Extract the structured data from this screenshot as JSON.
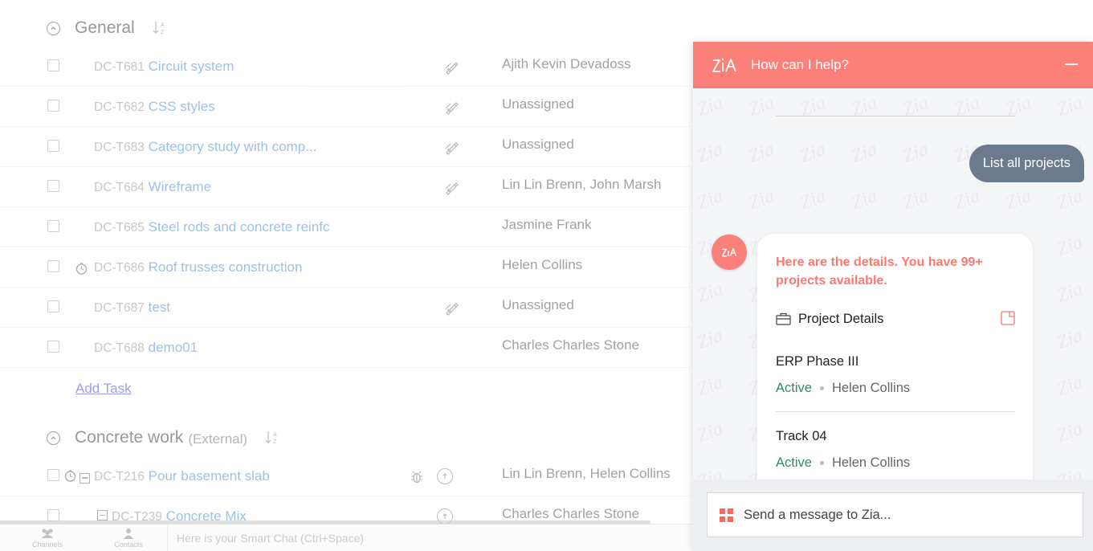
{
  "groups": [
    {
      "title": "General",
      "subtitle": "",
      "tasks": [
        {
          "id": "DC-T681",
          "name": "Circuit system",
          "owner": "Ajith Kevin Devadoss",
          "icon": "pencil-ruler-icon",
          "timer": false
        },
        {
          "id": "DC-T682",
          "name": "CSS styles",
          "owner": "Unassigned",
          "icon": "pencil-ruler-icon",
          "timer": false
        },
        {
          "id": "DC-T683",
          "name": "Category study with comp...",
          "owner": "Unassigned",
          "icon": "pencil-ruler-icon",
          "timer": false
        },
        {
          "id": "DC-T684",
          "name": "Wireframe",
          "owner": "Lin Lin Brenn, John Marsh",
          "icon": "pencil-ruler-icon",
          "timer": false
        },
        {
          "id": "DC-T685",
          "name": "Steel rods and concrete reinfc",
          "owner": "Jasmine Frank",
          "icon": "",
          "timer": false
        },
        {
          "id": "DC-T686",
          "name": "Roof trusses construction",
          "owner": "Helen Collins",
          "icon": "",
          "timer": true
        },
        {
          "id": "DC-T687",
          "name": "test",
          "owner": "Unassigned",
          "icon": "pencil-ruler-icon",
          "timer": false
        },
        {
          "id": "DC-T688",
          "name": "demo01",
          "owner": "Charles Charles Stone",
          "icon": "",
          "timer": false
        }
      ],
      "add_task_label": "Add Task"
    },
    {
      "title": "Concrete work",
      "subtitle": "(External)",
      "tasks": [
        {
          "id": "DC-T216",
          "name": "Pour basement slab",
          "owner": "Lin Lin Brenn, Helen Collins",
          "icon": "bug-icon",
          "timer": true
        },
        {
          "id": "DC-T239",
          "name": "Concrete Mix",
          "owner": "Charles Charles Stone",
          "icon": "",
          "timer": false
        }
      ]
    }
  ],
  "bottom_bar": {
    "channels_label": "Channels",
    "contacts_label": "Contacts",
    "chat_placeholder": "Here is your Smart Chat (Ctrl+Space)"
  },
  "zia": {
    "header_title": "How can I help?",
    "header_color": "#fa8079",
    "user_message": "List all projects",
    "bot_message": "Here are the details. You have 99+ projects available.",
    "card_title": "Project Details",
    "projects": [
      {
        "name": "ERP Phase III",
        "status": "Active",
        "owner": "Helen Collins"
      },
      {
        "name": "Track 04",
        "status": "Active",
        "owner": "Helen Collins"
      }
    ],
    "input_placeholder": "Send a message to Zia..."
  }
}
